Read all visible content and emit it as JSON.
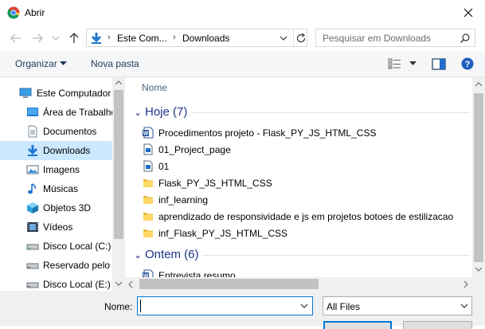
{
  "window": {
    "title": "Abrir"
  },
  "navigation": {
    "address_segments": [
      "Este Com...",
      "Downloads"
    ],
    "search_placeholder": "Pesquisar em Downloads"
  },
  "toolbar": {
    "organize_label": "Organizar",
    "new_folder_label": "Nova pasta"
  },
  "nav_pane": {
    "items": [
      {
        "label": "Este Computador",
        "icon": "computer-icon"
      },
      {
        "label": "Área de Trabalho",
        "icon": "desktop-icon"
      },
      {
        "label": "Documentos",
        "icon": "documents-icon"
      },
      {
        "label": "Downloads",
        "icon": "downloads-icon",
        "selected": true
      },
      {
        "label": "Imagens",
        "icon": "pictures-icon"
      },
      {
        "label": "Músicas",
        "icon": "music-icon"
      },
      {
        "label": "Objetos 3D",
        "icon": "3d-objects-icon"
      },
      {
        "label": "Vídeos",
        "icon": "videos-icon"
      },
      {
        "label": "Disco Local (C:)",
        "icon": "drive-icon"
      },
      {
        "label": "Reservado pelo S",
        "icon": "drive-icon"
      },
      {
        "label": "Disco Local (E:)",
        "icon": "drive-icon"
      }
    ]
  },
  "content": {
    "column_header": "Nome",
    "groups": [
      {
        "label": "Hoje (7)",
        "files": [
          {
            "name": "Procedimentos projeto - Flask_PY_JS_HTML_CSS",
            "icon": "word-doc-icon"
          },
          {
            "name": "01_Project_page",
            "icon": "document-icon"
          },
          {
            "name": "01",
            "icon": "document-icon"
          },
          {
            "name": "Flask_PY_JS_HTML_CSS",
            "icon": "folder-icon"
          },
          {
            "name": "inf_learning",
            "icon": "folder-icon"
          },
          {
            "name": "aprendizado de responsividade e js em projetos botoes de estilizacao",
            "icon": "folder-icon"
          },
          {
            "name": "inf_Flask_PY_JS_HTML_CSS",
            "icon": "folder-icon"
          }
        ]
      },
      {
        "label": "Ontem (6)",
        "files": [
          {
            "name": "Entrevista resumo",
            "icon": "word-doc-icon"
          }
        ]
      }
    ]
  },
  "bottom": {
    "name_label": "Nome:",
    "name_value": "",
    "file_type": "All Files"
  },
  "colors": {
    "accent": "#0078d7",
    "selected_bg": "#cce8ff",
    "group_header": "#1e3287",
    "folder": "#ffd866"
  }
}
